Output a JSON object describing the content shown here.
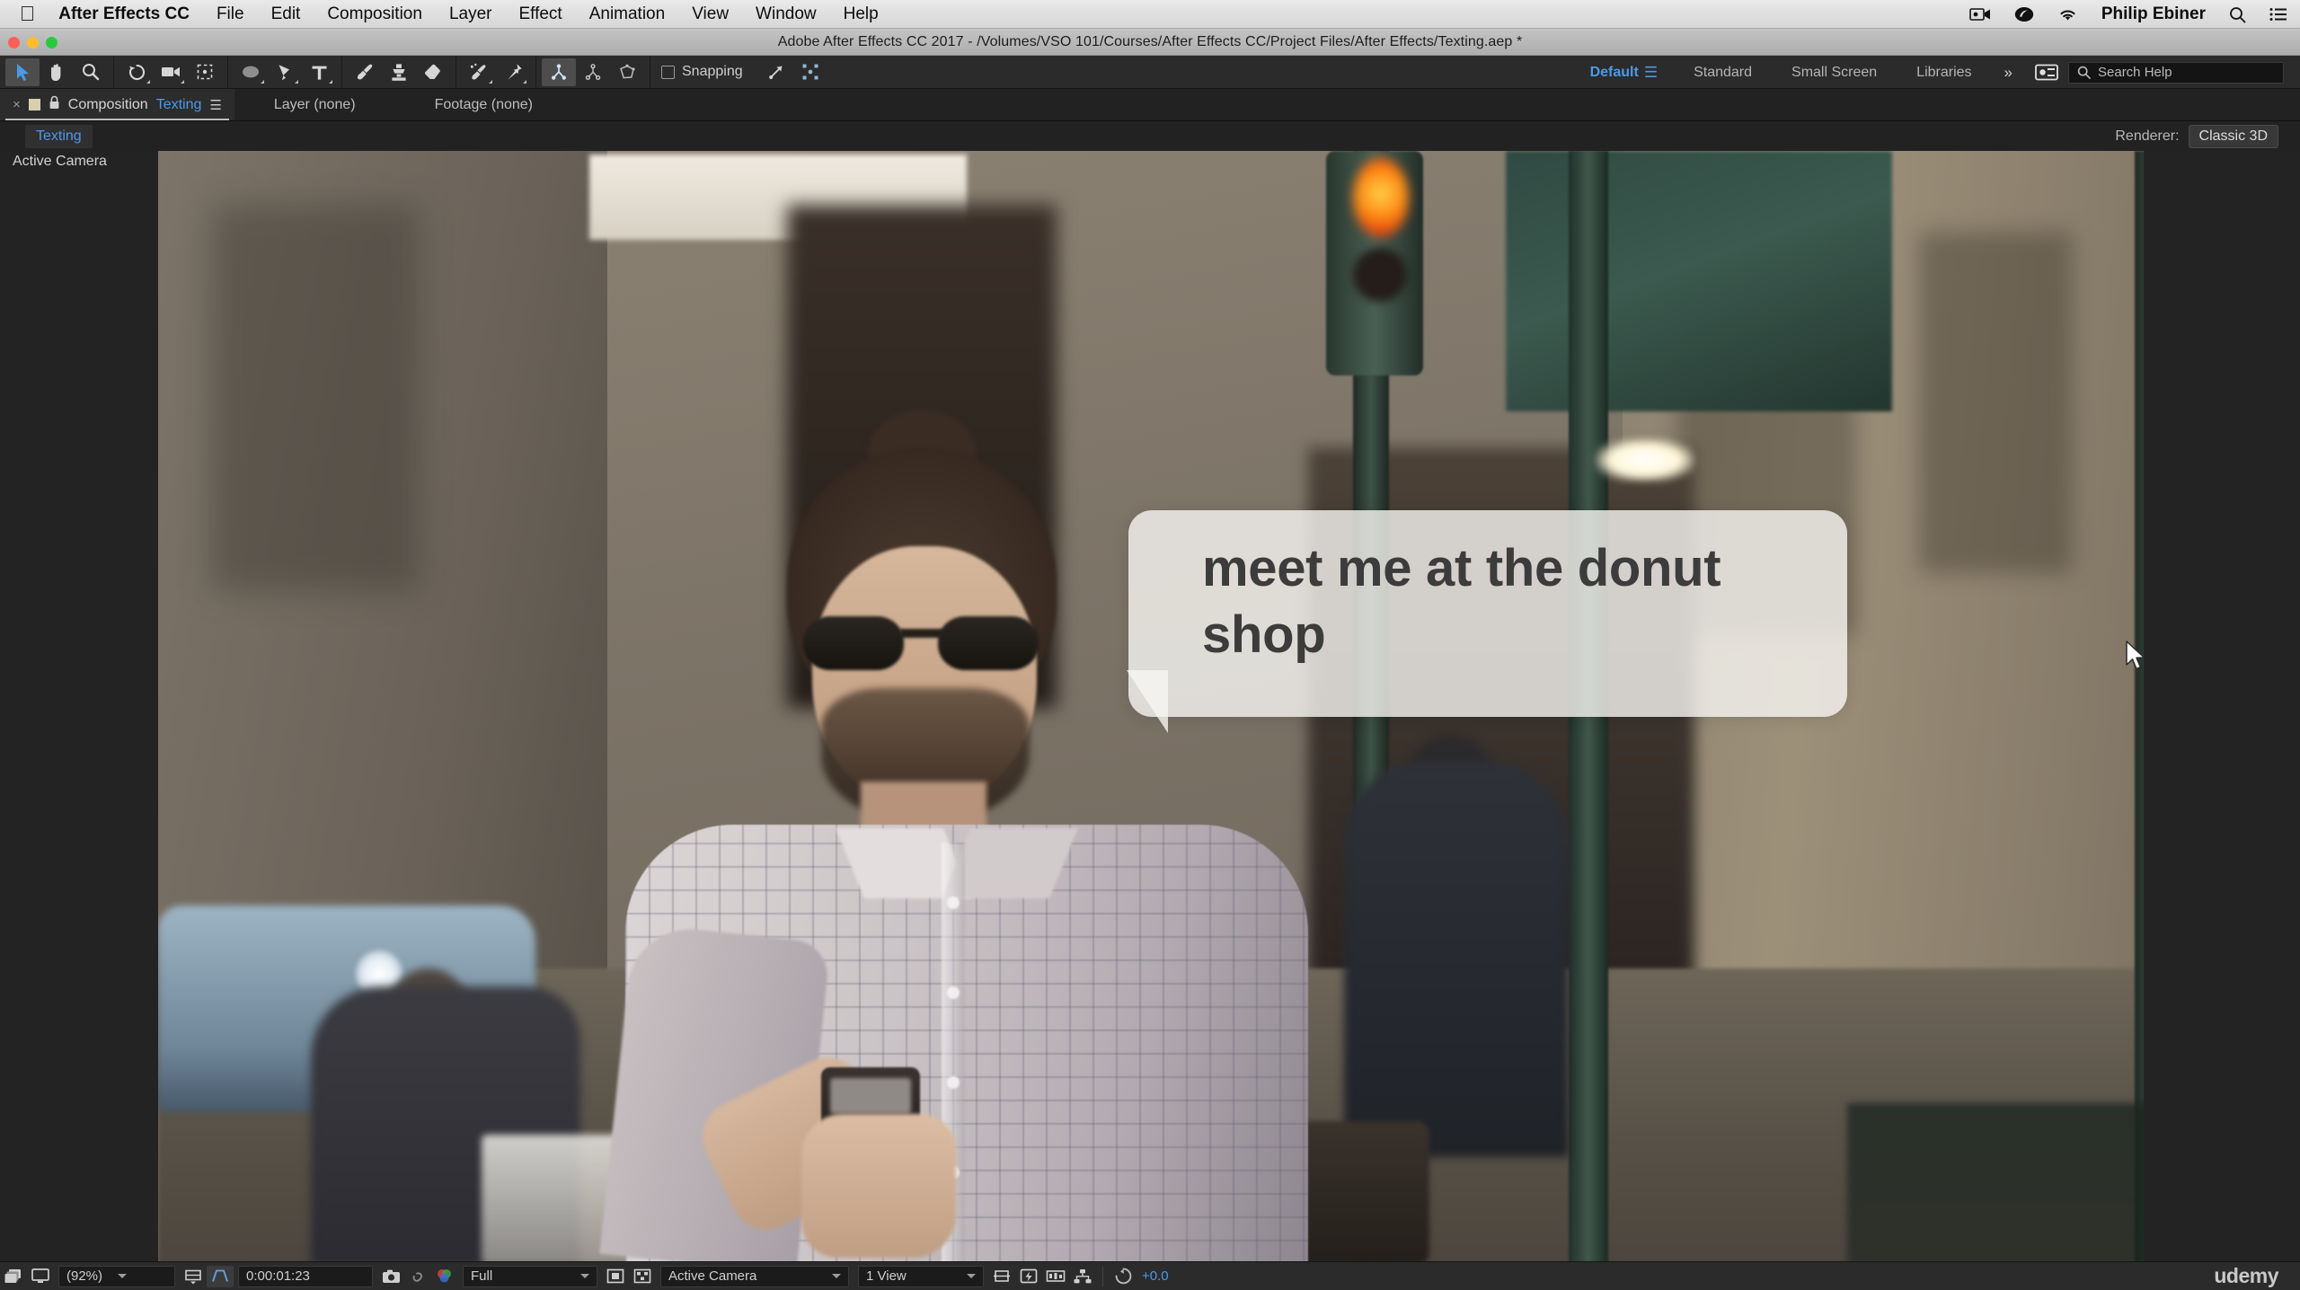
{
  "menubar": {
    "apple_icon": "apple-icon",
    "app_name": "After Effects CC",
    "items": [
      "File",
      "Edit",
      "Composition",
      "Layer",
      "Effect",
      "Animation",
      "View",
      "Window",
      "Help"
    ],
    "right": {
      "screen_record_icon": "screen-record-icon",
      "creative_cloud_icon": "creative-cloud-icon",
      "wifi_icon": "wifi-icon",
      "user_name": "Philip Ebiner",
      "search_icon": "spotlight-search-icon",
      "notification_icon": "notification-center-icon"
    }
  },
  "window": {
    "title": "Adobe After Effects CC 2017 - /Volumes/VSO 101/Courses/After Effects CC/Project Files/After Effects/Texting.aep *",
    "close_color": "#ff5f57",
    "minimize_color": "#ffbd2e",
    "zoom_color": "#28c940"
  },
  "toolbar": {
    "tools": [
      {
        "name": "selection-tool-icon",
        "label": "Selection Tool",
        "selected": true
      },
      {
        "name": "hand-tool-icon",
        "label": "Hand Tool",
        "selected": false
      },
      {
        "name": "zoom-tool-icon",
        "label": "Zoom Tool",
        "selected": false
      },
      {
        "name": "rotation-tool-icon",
        "label": "Rotation Tool",
        "selected": false
      },
      {
        "name": "camera-tool-icon",
        "label": "Unified Camera Tool",
        "selected": false
      },
      {
        "name": "pan-behind-tool-icon",
        "label": "Pan Behind Tool",
        "selected": false
      },
      {
        "name": "shape-tool-icon",
        "label": "Ellipse Tool",
        "selected": false
      },
      {
        "name": "pen-tool-icon",
        "label": "Pen Tool",
        "selected": false
      },
      {
        "name": "type-tool-icon",
        "label": "Type Tool",
        "selected": false
      },
      {
        "name": "brush-tool-icon",
        "label": "Brush Tool",
        "selected": false
      },
      {
        "name": "clone-stamp-tool-icon",
        "label": "Clone Stamp Tool",
        "selected": false
      },
      {
        "name": "eraser-tool-icon",
        "label": "Eraser Tool",
        "selected": false
      },
      {
        "name": "roto-brush-tool-icon",
        "label": "Roto Brush Tool",
        "selected": false
      },
      {
        "name": "puppet-pin-tool-icon",
        "label": "Puppet Pin Tool",
        "selected": false
      }
    ],
    "axis_modes": [
      {
        "name": "local-axis-mode-icon",
        "selected": true
      },
      {
        "name": "world-axis-mode-icon",
        "selected": false
      },
      {
        "name": "view-axis-mode-icon",
        "selected": false
      }
    ],
    "snapping_label": "Snapping",
    "snapping_checked": false,
    "snap_extra_icons": [
      "snap-to-feature-icon",
      "snap-grid-icon"
    ]
  },
  "workspaces": {
    "active": "Default",
    "items": [
      "Default",
      "Standard",
      "Small Screen",
      "Libraries"
    ],
    "menu_icon": "workspace-menu-icon",
    "overflow_label": "»",
    "sync_settings_icon": "sync-settings-icon",
    "accent": "#4a9ae8"
  },
  "search": {
    "placeholder": "Search Help",
    "value": "",
    "icon": "search-icon"
  },
  "panel_tabs": {
    "close_icon": "close-tab-icon",
    "thumbnail_icon": "composition-thumbnail-icon",
    "lock_icon": "lock-icon",
    "composition_label": "Composition",
    "composition_name": "Texting",
    "panel_menu_icon": "panel-menu-icon",
    "layer_tab": "Layer (none)",
    "footage_tab": "Footage (none)"
  },
  "breadcrumb": {
    "item": "Texting"
  },
  "renderer": {
    "label": "Renderer:",
    "value": "Classic 3D"
  },
  "viewer": {
    "camera_label": "Active Camera",
    "cursor_icon": "mouse-pointer-icon"
  },
  "composition": {
    "bubble_text": "meet me at the donut shop",
    "bubble_fill": "#f8f6f3",
    "bubble_text_color": "#3c3c3c",
    "scene_description": "Man with bun and sunglasses looking at phone on city street"
  },
  "statusbar": {
    "always_preview_icon": "always-preview-this-view-icon",
    "main_display_icon": "main-display-icon",
    "zoom_value": "(92%)",
    "zoom_caret": "chevron-down-icon",
    "grid_guides_icon": "choose-grid-and-guide-options-icon",
    "region_of_interest_icon": "region-of-interest-icon",
    "timecode": "0:00:01:23",
    "snapshot_icon": "take-snapshot-icon",
    "show_snapshot_icon": "show-snapshot-icon",
    "channels_icon": "show-channel-icon",
    "resolution_value": "Full",
    "resolution_caret": "chevron-down-icon",
    "toggle_mask_icon": "toggle-mask-and-shape-path-visibility-icon",
    "transparency_grid_icon": "toggle-transparency-grid-icon",
    "camera_value": "Active Camera",
    "camera_caret": "chevron-down-icon",
    "views_value": "1 View",
    "views_caret": "chevron-down-icon",
    "pixel_aspect_icon": "toggle-pixel-aspect-ratio-correction-icon",
    "fast_previews_icon": "fast-previews-icon",
    "timeline_icon": "timeline-icon",
    "comp_flowchart_icon": "comp-flowchart-icon",
    "exposure_icon": "reset-exposure-icon",
    "exposure_value": "+0.0",
    "exposure_color": "#4a9ae8"
  },
  "watermark": {
    "text": "udemy"
  }
}
